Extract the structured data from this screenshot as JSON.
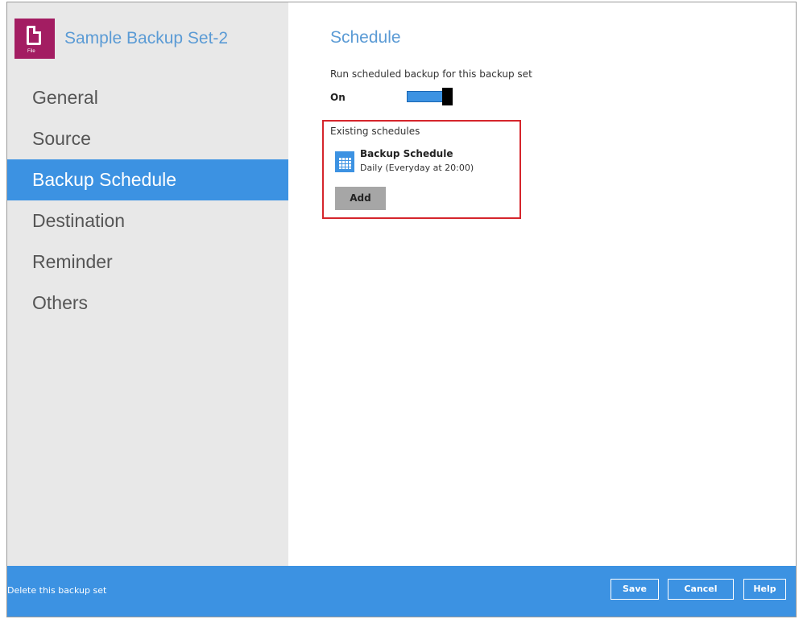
{
  "sidebar": {
    "backup_set_name": "Sample Backup Set-2",
    "file_icon_tag": "File",
    "items": [
      {
        "label": "General",
        "active": false
      },
      {
        "label": "Source",
        "active": false
      },
      {
        "label": "Backup Schedule",
        "active": true
      },
      {
        "label": "Destination",
        "active": false
      },
      {
        "label": "Reminder",
        "active": false
      },
      {
        "label": "Others",
        "active": false
      }
    ]
  },
  "main": {
    "title": "Schedule",
    "run_scheduled_label": "Run scheduled backup for this backup set",
    "toggle_state_label": "On",
    "toggle_on": true,
    "existing_schedules_label": "Existing schedules",
    "schedules": [
      {
        "name": "Backup Schedule",
        "description": "Daily (Everyday at 20:00)",
        "icon": "calendar-icon"
      }
    ],
    "add_label": "Add"
  },
  "footer": {
    "delete_label": "Delete this backup set",
    "save_label": "Save",
    "cancel_label": "Cancel",
    "help_label": "Help"
  },
  "colors": {
    "accent": "#3c92e2",
    "title_blue": "#5b9bd5",
    "highlight_border": "#d5252c",
    "file_icon": "#a31d62",
    "sidebar_bg": "#e8e8e8"
  }
}
